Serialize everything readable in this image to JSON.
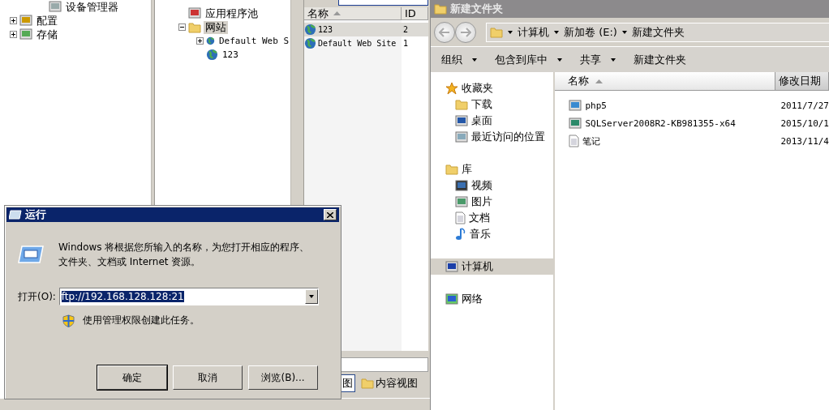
{
  "mmc": {
    "console_tree": [
      {
        "label": "设备管理器",
        "kind": "leaf"
      },
      {
        "label": "配置",
        "kind": "collapsed"
      },
      {
        "label": "存储",
        "kind": "collapsed"
      }
    ],
    "connections_tree": [
      {
        "label": "应用程序池",
        "kind": "leaf",
        "selected": false
      },
      {
        "label": "网站",
        "kind": "expanded",
        "selected": true,
        "children": [
          {
            "label": "Default Web S",
            "kind": "collapsed",
            "selected": false
          },
          {
            "label": "123",
            "kind": "leaf",
            "selected": false
          }
        ]
      }
    ],
    "sites_list": {
      "columns": [
        {
          "label": "名称",
          "sorted": true
        },
        {
          "label": "ID",
          "sorted": false
        }
      ],
      "rows": [
        {
          "name": "123",
          "id": "2",
          "selected": true
        },
        {
          "name": "Default Web Site",
          "id": "1",
          "selected": false
        }
      ]
    },
    "view_tabs": [
      {
        "label": "图",
        "selected": true
      },
      {
        "label": "内容视图",
        "selected": false
      }
    ]
  },
  "explorer": {
    "title": "新建文件夹",
    "breadcrumb": [
      "计算机",
      "新加卷 (E:)",
      "新建文件夹"
    ],
    "toolbar": [
      {
        "label": "组织",
        "dropdown": true
      },
      {
        "label": "包含到库中",
        "dropdown": true
      },
      {
        "label": "共享",
        "dropdown": true
      },
      {
        "label": "新建文件夹",
        "dropdown": false
      }
    ],
    "navigation": [
      {
        "label": "收藏夹",
        "selected": false,
        "children": [
          {
            "label": "下载",
            "selected": false
          },
          {
            "label": "桌面",
            "selected": false
          },
          {
            "label": "最近访问的位置",
            "selected": false
          }
        ]
      },
      {
        "label": "库",
        "selected": false,
        "children": [
          {
            "label": "视频",
            "selected": false
          },
          {
            "label": "图片",
            "selected": false
          },
          {
            "label": "文档",
            "selected": false
          },
          {
            "label": "音乐",
            "selected": false
          }
        ]
      },
      {
        "label": "计算机",
        "selected": true
      },
      {
        "label": "网络",
        "selected": false
      }
    ],
    "columns": [
      {
        "label": "名称",
        "sorted": true
      },
      {
        "label": "修改日期",
        "sorted": false
      }
    ],
    "files": [
      {
        "name": "php5",
        "modified": "2011/7/27"
      },
      {
        "name": "SQLServer2008R2-KB981355-x64",
        "modified": "2015/10/1"
      },
      {
        "name": "笔记",
        "modified": "2013/11/4"
      }
    ]
  },
  "run_dialog": {
    "title": "运行",
    "description_lines": [
      "Windows 将根据您所输入的名称，为您打开相应的程序、",
      "文件夹、文档或 Internet 资源。"
    ],
    "open_label": "打开(O):",
    "value": "ftp://192.168.128.128:21",
    "value_selected": true,
    "admin_note": "使用管理权限创建此任务。",
    "buttons": [
      {
        "label": "确定",
        "default": true
      },
      {
        "label": "取消",
        "default": false
      },
      {
        "label": "浏览(B)...",
        "default": false
      }
    ]
  }
}
